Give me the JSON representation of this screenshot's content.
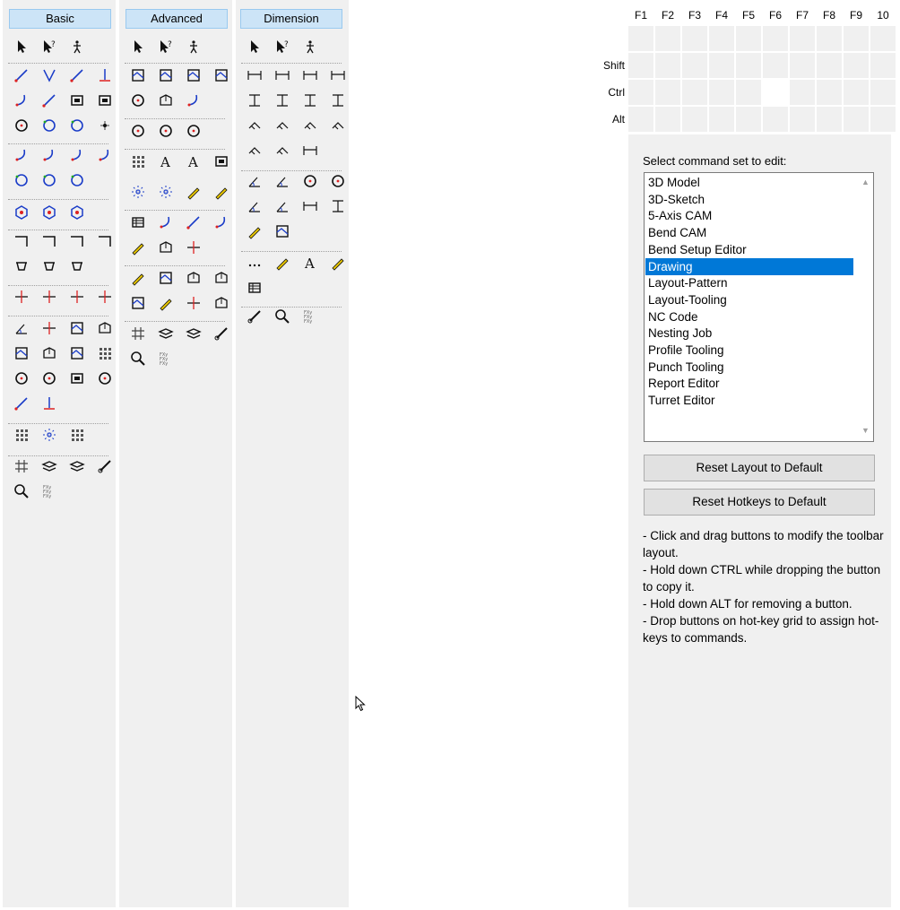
{
  "toolbox": {
    "tabs": [
      {
        "label": "Basic"
      },
      {
        "label": "Advanced"
      },
      {
        "label": "Dimension"
      }
    ]
  },
  "hotkeys": {
    "function_keys": [
      "F1",
      "F2",
      "F3",
      "F4",
      "F5",
      "F6",
      "F7",
      "F8",
      "F9",
      "10"
    ],
    "modifiers": [
      "Shift",
      "Ctrl",
      "Alt"
    ]
  },
  "command_set": {
    "label": "Select command set to edit:",
    "selected": "Drawing",
    "items": [
      "3D Model",
      "3D-Sketch",
      "5-Axis CAM",
      "Bend CAM",
      "Bend Setup Editor",
      "Drawing",
      "Layout-Pattern",
      "Layout-Tooling",
      "NC Code",
      "Nesting Job",
      "Profile Tooling",
      "Punch Tooling",
      "Report Editor",
      "Turret Editor"
    ]
  },
  "buttons": {
    "reset_layout": "Reset Layout to Default",
    "reset_hotkeys": "Reset Hotkeys to Default"
  },
  "help": {
    "lines": [
      "- Click and drag buttons to modify the toolbar layout.",
      "- Hold down CTRL while dropping the button to copy it.",
      "- Hold down ALT for removing a button.",
      "- Drop buttons on hot-key grid to assign hot-keys to commands."
    ]
  },
  "colors": {
    "tab_bg": "#cce4f7",
    "selection": "#0078d7",
    "panel_bg": "#f0f0f0"
  }
}
